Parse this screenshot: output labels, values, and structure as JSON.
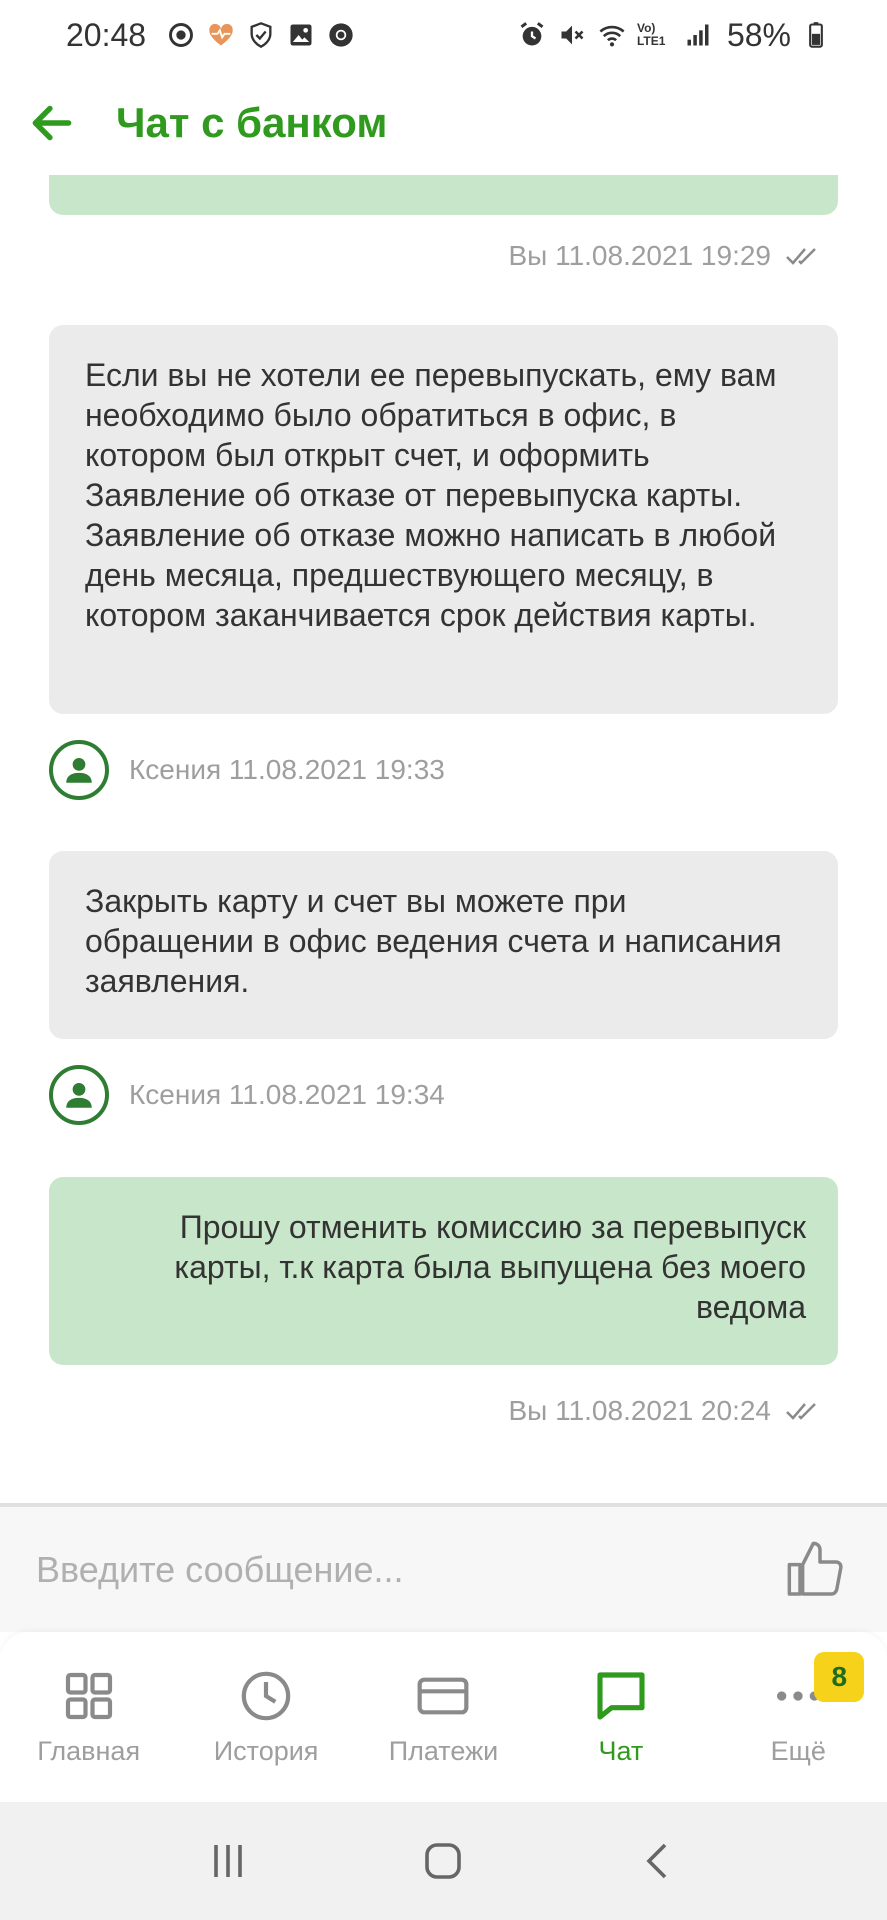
{
  "status_bar": {
    "time": "20:48",
    "battery": "58%",
    "icons_left": [
      "record-icon",
      "heart-health-icon",
      "shield-icon",
      "gallery-icon",
      "chrome-icon"
    ],
    "icons_right": [
      "alarm-icon",
      "mute-icon",
      "wifi-icon",
      "volte-icon",
      "signal-icon",
      "battery-icon"
    ],
    "volte_label": "Vo) LTE1"
  },
  "app_bar": {
    "title": "Чат с банком",
    "accent": "#2f9a1e"
  },
  "messages": [
    {
      "from": "user",
      "text": "",
      "meta": "Вы 11.08.2021 19:29",
      "read": true
    },
    {
      "from": "bank",
      "text": "Если вы не хотели ее перевыпускать, ему вам необходимо было обратиться в офис, в котором был открыт счет, и оформить Заявление об отказе от перевыпуска карты. Заявление об отказе можно написать в любой день месяца, предшествующего месяцу, в котором заканчивается срок действия карты.",
      "meta": "Ксения 11.08.2021 19:33"
    },
    {
      "from": "bank",
      "text": "Закрыть карту и счет вы можете при обращении в офис ведения счета и написания заявления.",
      "meta": "Ксения 11.08.2021 19:34"
    },
    {
      "from": "user",
      "text": "Прошу отменить комиссию за перевыпуск карты, т.к карта была выпущена без моего ведома",
      "meta": "Вы 11.08.2021 20:24",
      "read": true
    }
  ],
  "input": {
    "placeholder": "Введите сообщение...",
    "value": ""
  },
  "bottom_nav": {
    "items": [
      {
        "label": "Главная",
        "icon": "grid-icon"
      },
      {
        "label": "История",
        "icon": "clock-icon"
      },
      {
        "label": "Платежи",
        "icon": "card-icon"
      },
      {
        "label": "Чат",
        "icon": "chat-icon",
        "active": true
      },
      {
        "label": "Ещё",
        "icon": "more-icon",
        "badge": "8"
      }
    ]
  },
  "colors": {
    "user_bubble": "#c8e6c9",
    "bank_bubble": "#ebebeb",
    "badge": "#f6d21a"
  }
}
